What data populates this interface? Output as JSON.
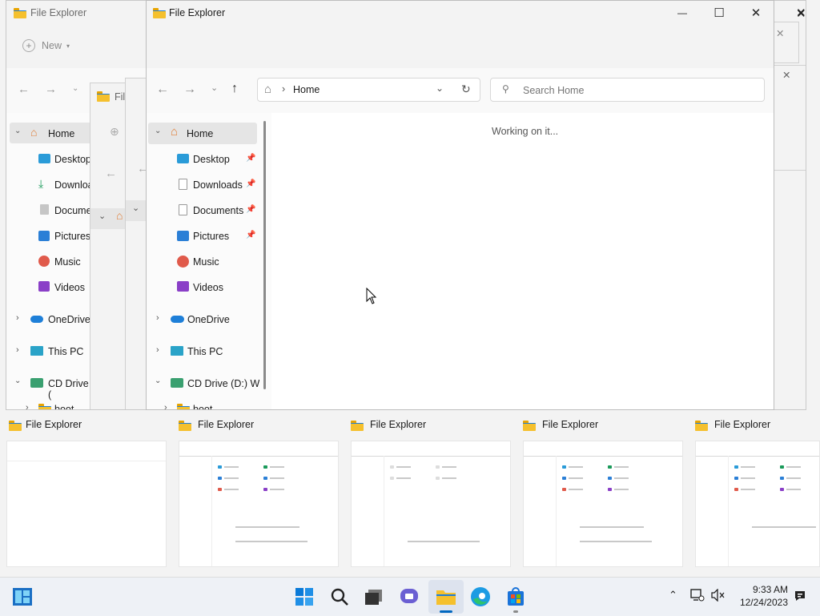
{
  "window_title": "File Explorer",
  "caption": {
    "minimize": "—",
    "maximize": "☐",
    "close": "✕"
  },
  "address": {
    "location": "Home",
    "separator": "›"
  },
  "search": {
    "placeholder": "Search Home"
  },
  "status": {
    "working": "Working on it..."
  },
  "bg_window": {
    "new_label": "New",
    "title": "File Explorer",
    "title_short": "File"
  },
  "sidebar": {
    "home": "Home",
    "items": [
      {
        "label": "Desktop",
        "icon": "desktop-icon",
        "pinned": true
      },
      {
        "label": "Downloads",
        "icon": "downloads-icon",
        "pinned": true
      },
      {
        "label": "Documents",
        "icon": "documents-icon",
        "pinned": true
      },
      {
        "label": "Pictures",
        "icon": "pictures-icon",
        "pinned": true
      },
      {
        "label": "Music",
        "icon": "music-icon",
        "pinned": false
      },
      {
        "label": "Videos",
        "icon": "videos-icon",
        "pinned": false
      }
    ],
    "onedrive": "OneDrive",
    "thispc": "This PC",
    "cddrive": "CD Drive (D:) Wir",
    "cddrive_short": "CD Drive (",
    "boot": "boot",
    "bg_labels": [
      "Desktop",
      "Downloa",
      "Docume",
      "Pictures",
      "Music",
      "Videos"
    ]
  },
  "thumbnails": [
    "File Explorer",
    "File Explorer",
    "File Explorer",
    "File Explorer",
    "File Explorer"
  ],
  "clock": {
    "time": "9:33 AM",
    "date": "12/24/2023"
  },
  "colors": {
    "accent": "#0067c0",
    "folder": "#f5c02d",
    "selection": "#e5e5e5"
  }
}
